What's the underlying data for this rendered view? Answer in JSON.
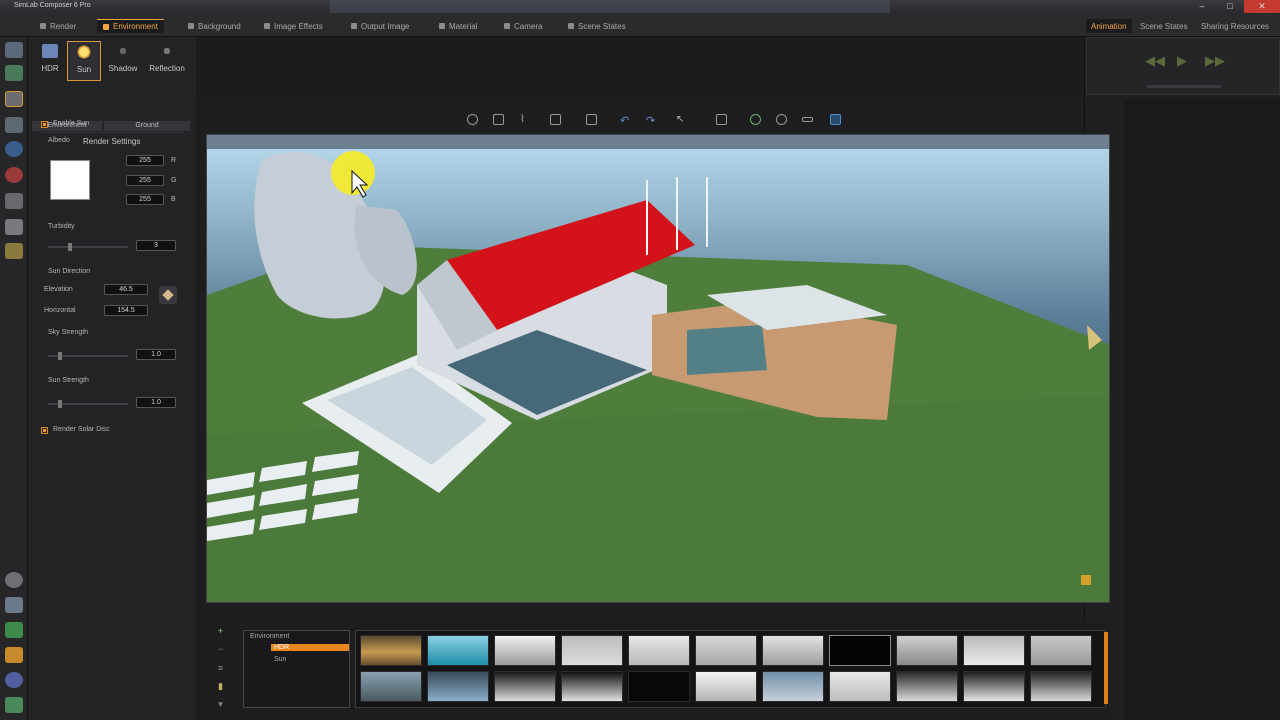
{
  "app": {
    "title": "SimLab Composer 6 Pro"
  },
  "main_tabs": [
    {
      "label": "Render",
      "active": false
    },
    {
      "label": "Environment",
      "active": true
    },
    {
      "label": "Background",
      "active": false
    },
    {
      "label": "Image Effects",
      "active": false
    },
    {
      "label": "Output Image",
      "active": false
    },
    {
      "label": "Material",
      "active": false
    },
    {
      "label": "Camera",
      "active": false
    },
    {
      "label": "Scene States",
      "active": false
    }
  ],
  "right_tabs": [
    {
      "label": "Animation",
      "active": true
    },
    {
      "label": "Scene States",
      "active": false
    },
    {
      "label": "Sharing Resources",
      "active": false
    }
  ],
  "env_buttons": [
    {
      "label": "HDR",
      "icon": "hdr-icon"
    },
    {
      "label": "Sun",
      "icon": "sun-icon",
      "active": true
    },
    {
      "label": "Shadow",
      "icon": "shadow-icon"
    },
    {
      "label": "Reflection",
      "icon": "reflection-icon"
    }
  ],
  "sub_tabs": {
    "environment": "Environment",
    "ground": "Ground"
  },
  "render_settings": {
    "title": "Render Settings",
    "enable_sun": "Enable Sun",
    "albedo": "Albedo",
    "albedo_r": "255",
    "albedo_g": "255",
    "albedo_b": "255",
    "r_label": "R",
    "g_label": "G",
    "b_label": "B",
    "turbidity": "Turbidity",
    "turbidity_value": "3",
    "sun_direction": "Sun Direction",
    "elevation_label": "Elevation",
    "elevation_value": "46.5",
    "horizontal_label": "Horizontal",
    "horizontal_value": "154.5",
    "sky_strength": "Sky Strength",
    "sky_strength_value": "1.0",
    "sun_strength": "Sun Strength",
    "sun_strength_value": "1.0",
    "render_solar_disc": "Render Solar Disc"
  },
  "env_tree": {
    "root": "Environment",
    "selected": "HDR",
    "child": "Sun"
  },
  "colors": {
    "accent": "#e8871f",
    "panel_bg": "#232326",
    "roof_red": "#d4121a",
    "grass": "#4d7a3a"
  }
}
